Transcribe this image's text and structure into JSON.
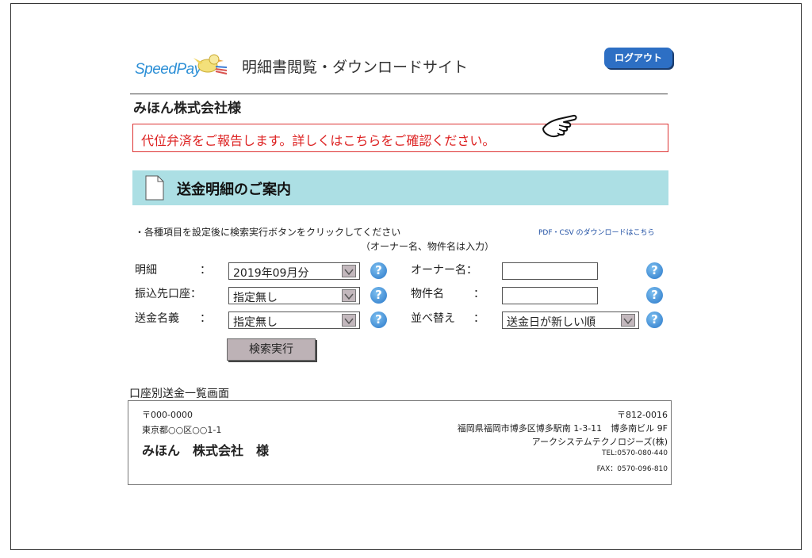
{
  "header": {
    "logo_text": "SpeedPay",
    "site_title": "明細書閲覧・ダウンロードサイト",
    "logout_label": "ログアウト"
  },
  "company_name": "みほん株式会社様",
  "notice": "代位弁済をご報告します。詳しくはこちらをご確認ください。",
  "section_title": "送金明細のご案内",
  "instructions": {
    "line1": "・各種項目を設定後に検索実行ボタンをクリックしてください",
    "line2": "（オーナー名、物件名は入力）",
    "download_link": "PDF・CSV のダウンロードはこちら"
  },
  "form": {
    "detail_label": "明細",
    "detail_colon": "：",
    "detail_value": "2019年09月分",
    "account_label": "振込先口座：",
    "account_value": "指定無し",
    "sender_label": "送金名義",
    "sender_colon": "：",
    "sender_value": "指定無し",
    "owner_label": "オーナー名：",
    "owner_value": "",
    "property_label": "物件名",
    "property_colon": "：",
    "property_value": "",
    "sort_label": "並べ替え",
    "sort_colon": "：",
    "sort_value": "送金日が新しい順",
    "help_symbol": "?",
    "search_button": "検索実行"
  },
  "list_section_label": "口座別送金一覧画面",
  "recipient": {
    "postal": "〒000-0000",
    "address": "東京都○○区○○1-1",
    "name": "みほん　株式会社　様"
  },
  "sender": {
    "postal": "〒812-0016",
    "address": "福岡県福岡市博多区博多駅南 1-3-11　博多南ビル 9F",
    "company": "アークシステムテクノロジーズ(株)",
    "tel": "TEL:0570-080-440",
    "fax": "FAX：0570-096-810"
  },
  "colors": {
    "accent_blue": "#2d6fc4",
    "banner_bg": "#acdfe4",
    "notice_red": "#d22",
    "button_gray": "#bdb2b6"
  }
}
